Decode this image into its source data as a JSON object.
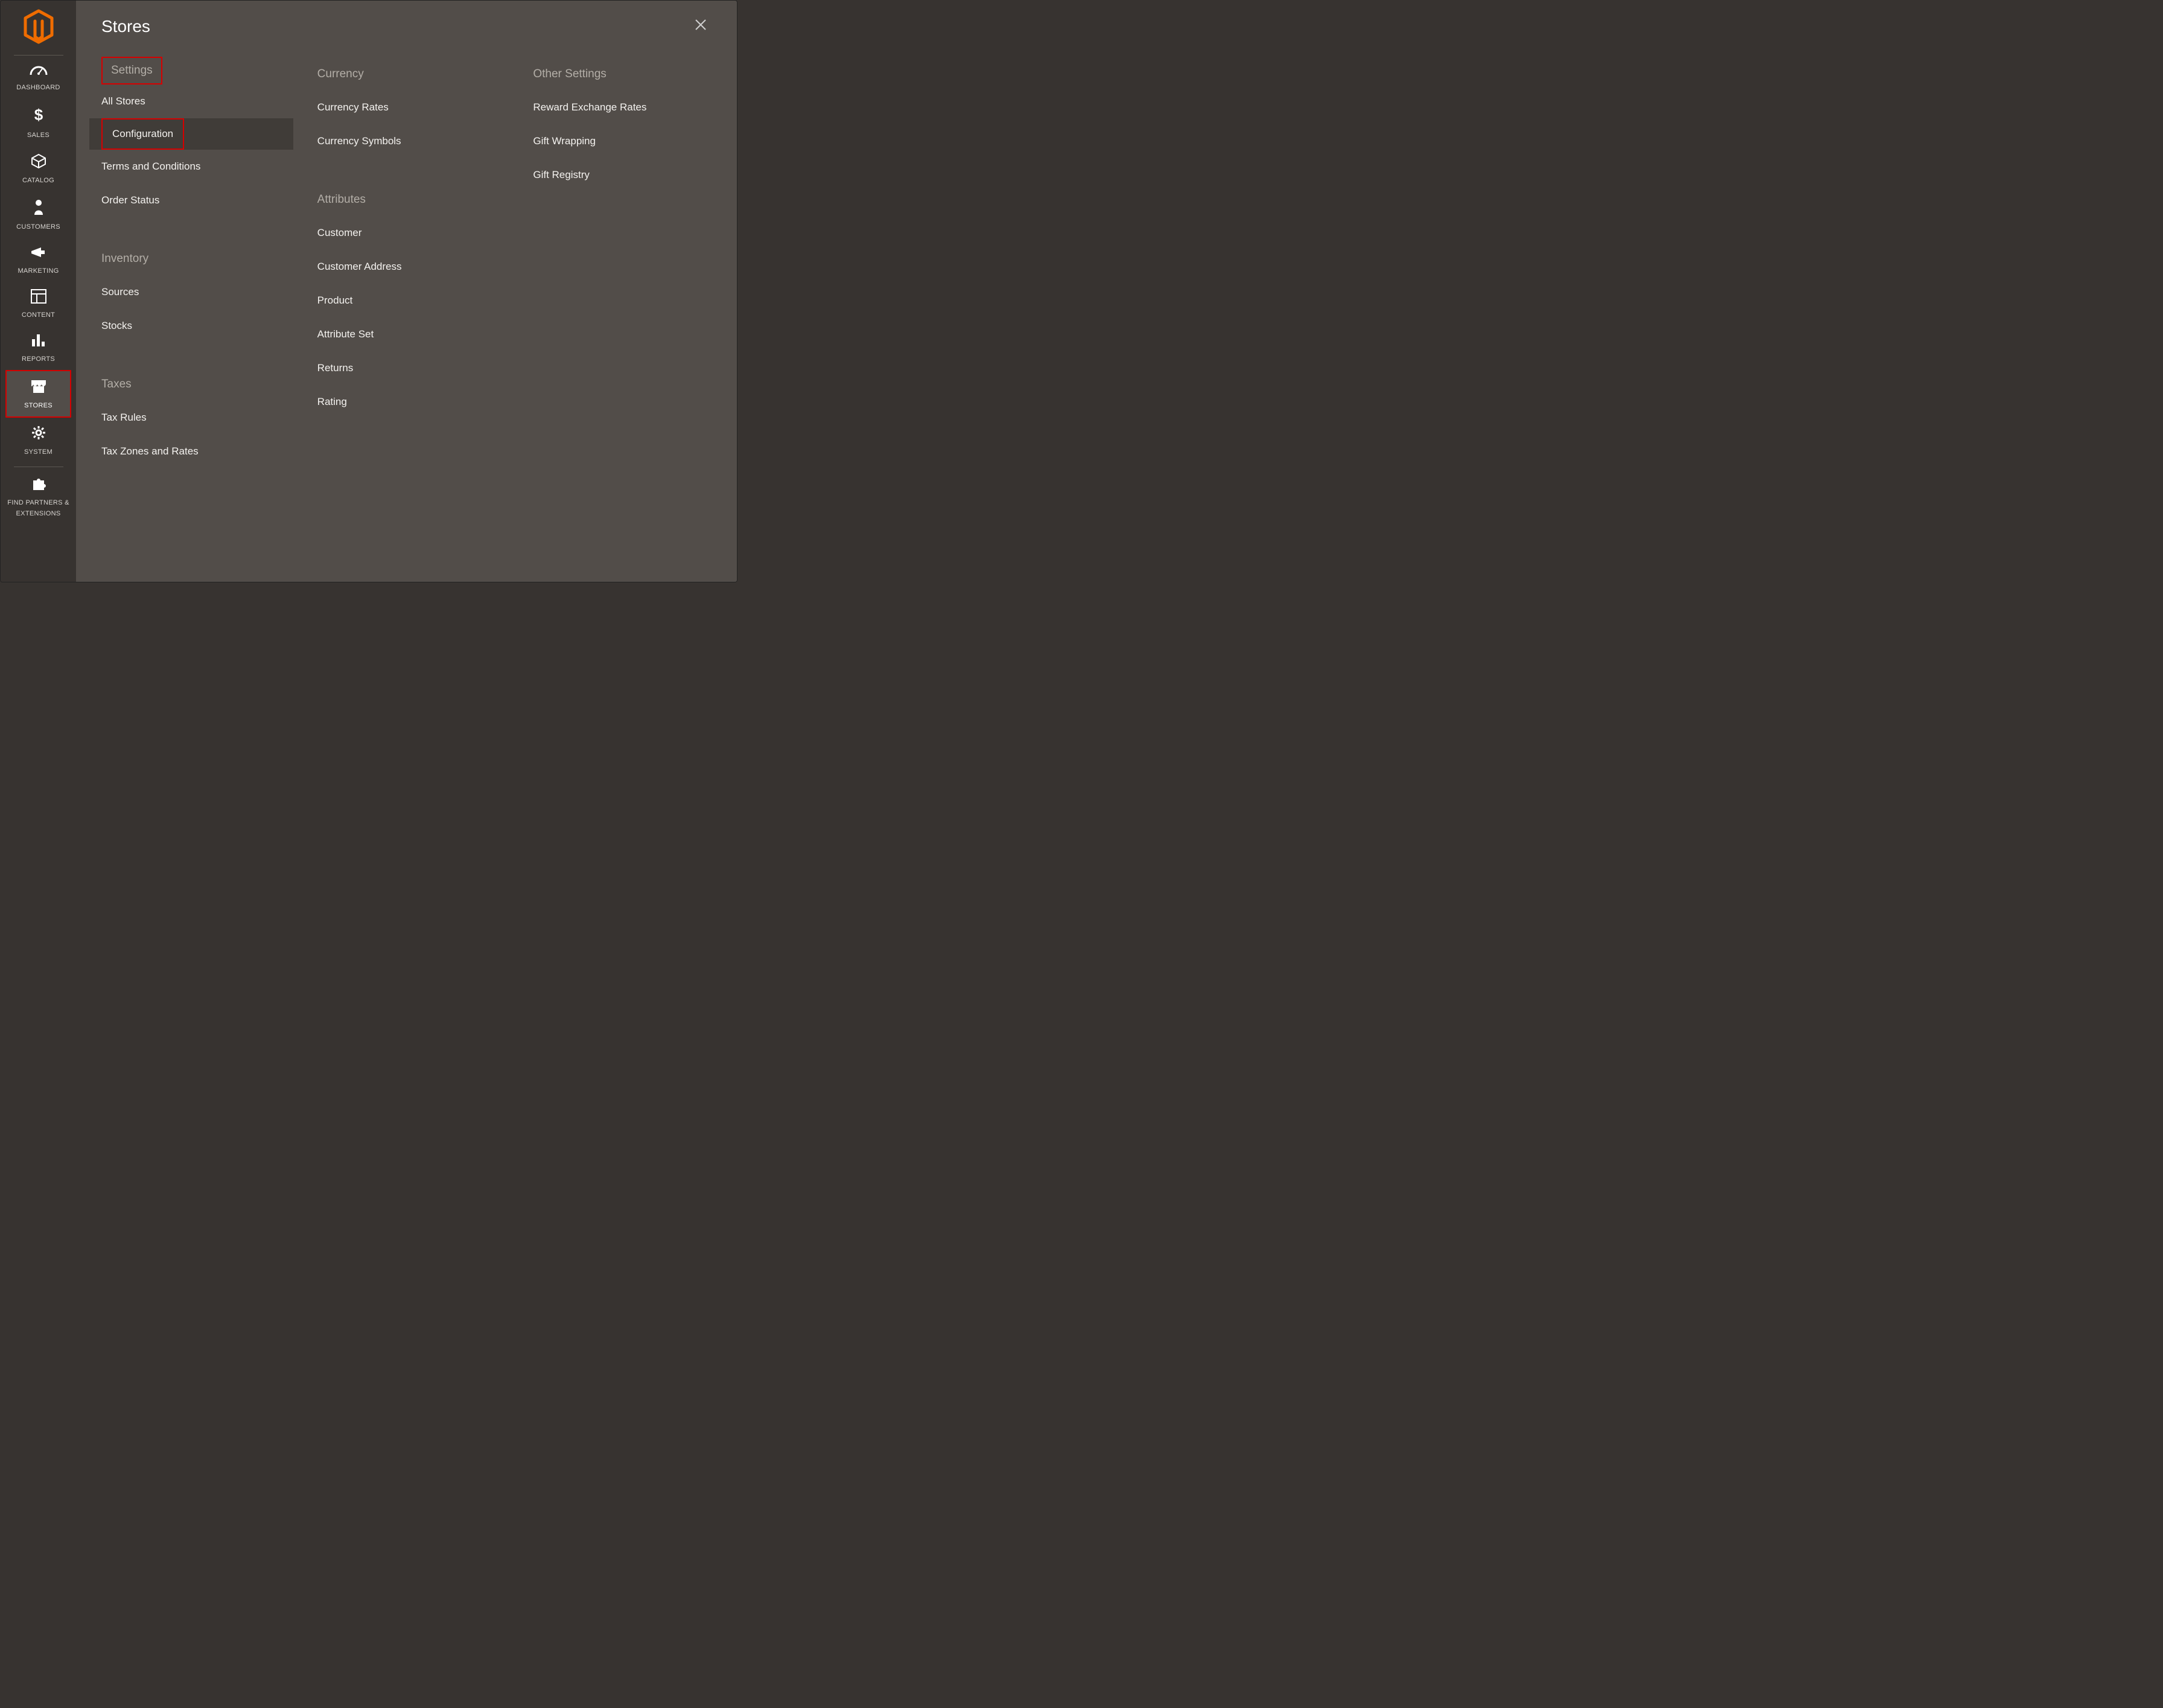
{
  "sidebar": {
    "items": [
      {
        "label": "DASHBOARD"
      },
      {
        "label": "SALES"
      },
      {
        "label": "CATALOG"
      },
      {
        "label": "CUSTOMERS"
      },
      {
        "label": "MARKETING"
      },
      {
        "label": "CONTENT"
      },
      {
        "label": "REPORTS"
      },
      {
        "label": "STORES"
      },
      {
        "label": "SYSTEM"
      },
      {
        "label": "FIND PARTNERS & EXTENSIONS"
      }
    ]
  },
  "panel": {
    "title": "Stores",
    "columns": [
      {
        "sections": [
          {
            "title": "Settings",
            "highlighted_title": true,
            "items": [
              {
                "label": "All Stores"
              },
              {
                "label": "Configuration",
                "active": true,
                "highlighted": true
              },
              {
                "label": "Terms and Conditions"
              },
              {
                "label": "Order Status"
              }
            ]
          },
          {
            "title": "Inventory",
            "items": [
              {
                "label": "Sources"
              },
              {
                "label": "Stocks"
              }
            ]
          },
          {
            "title": "Taxes",
            "items": [
              {
                "label": "Tax Rules"
              },
              {
                "label": "Tax Zones and Rates"
              }
            ]
          }
        ]
      },
      {
        "sections": [
          {
            "title": "Currency",
            "items": [
              {
                "label": "Currency Rates"
              },
              {
                "label": "Currency Symbols"
              }
            ]
          },
          {
            "title": "Attributes",
            "items": [
              {
                "label": "Customer"
              },
              {
                "label": "Customer Address"
              },
              {
                "label": "Product"
              },
              {
                "label": "Attribute Set"
              },
              {
                "label": "Returns"
              },
              {
                "label": "Rating"
              }
            ]
          }
        ]
      },
      {
        "sections": [
          {
            "title": "Other Settings",
            "items": [
              {
                "label": "Reward Exchange Rates"
              },
              {
                "label": "Gift Wrapping"
              },
              {
                "label": "Gift Registry"
              }
            ]
          }
        ]
      }
    ]
  }
}
